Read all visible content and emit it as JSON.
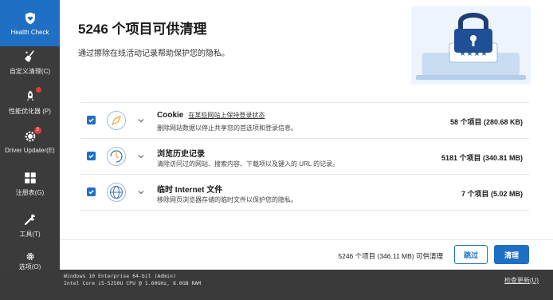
{
  "sidebar": {
    "items": [
      {
        "label": "Health Check",
        "icon": "heart-shield-icon",
        "active": true
      },
      {
        "label": "自定义清理(C)",
        "icon": "broom-icon"
      },
      {
        "label": "性能优化器 (P)",
        "icon": "rocket-icon",
        "badge": ""
      },
      {
        "label": "Driver Updater(E)",
        "icon": "gear-update-icon",
        "badge": "3"
      },
      {
        "label": "注册表(G)",
        "icon": "grid-icon"
      },
      {
        "label": "工具(T)",
        "icon": "wrench-icon"
      },
      {
        "label": "选项(O)",
        "icon": "settings-gear-icon"
      }
    ]
  },
  "header": {
    "title": "5246 个项目可供清理",
    "subtitle": "通过擦除在线活动记录帮助保护您的隐私。",
    "hero_icon": "padlock-password-illustration"
  },
  "items": [
    {
      "name": "Cookie",
      "link": "在某些网站上保持登录状态",
      "desc": "删除网站数据以停止共享您的首选项和登录信息。",
      "count": "58 个项目 (280.68 KB)",
      "checked": true,
      "icon": "cookie-compass-icon"
    },
    {
      "name": "浏览历史记录",
      "link": "",
      "desc": "清除访问过的网站、搜索内容、下载项以及键入的 URL 的记录。",
      "count": "5181 个项目 (340.81 MB)",
      "checked": true,
      "icon": "history-clock-icon"
    },
    {
      "name": "临时 Internet 文件",
      "link": "",
      "desc": "移除网页浏览器存储的临时文件以保护您的隐私。",
      "count": "7 个项目 (5.02 MB)",
      "checked": true,
      "icon": "globe-icon"
    }
  ],
  "footer": {
    "summary": "5246 个项目 (346.11 MB) 可供清理",
    "skip_label": "跳过",
    "clean_label": "清理"
  },
  "status": {
    "os": "Windows 10 Enterprise 64-bit (Admin)",
    "hw": "Intel Core i5-5250U CPU @ 1.60GHz, 8.0GB RAM",
    "update_link": "检查更新(U)"
  },
  "colors": {
    "accent": "#1f6fc4",
    "sidebar": "#3b3b3b",
    "statusbar": "#3a3a3a"
  }
}
